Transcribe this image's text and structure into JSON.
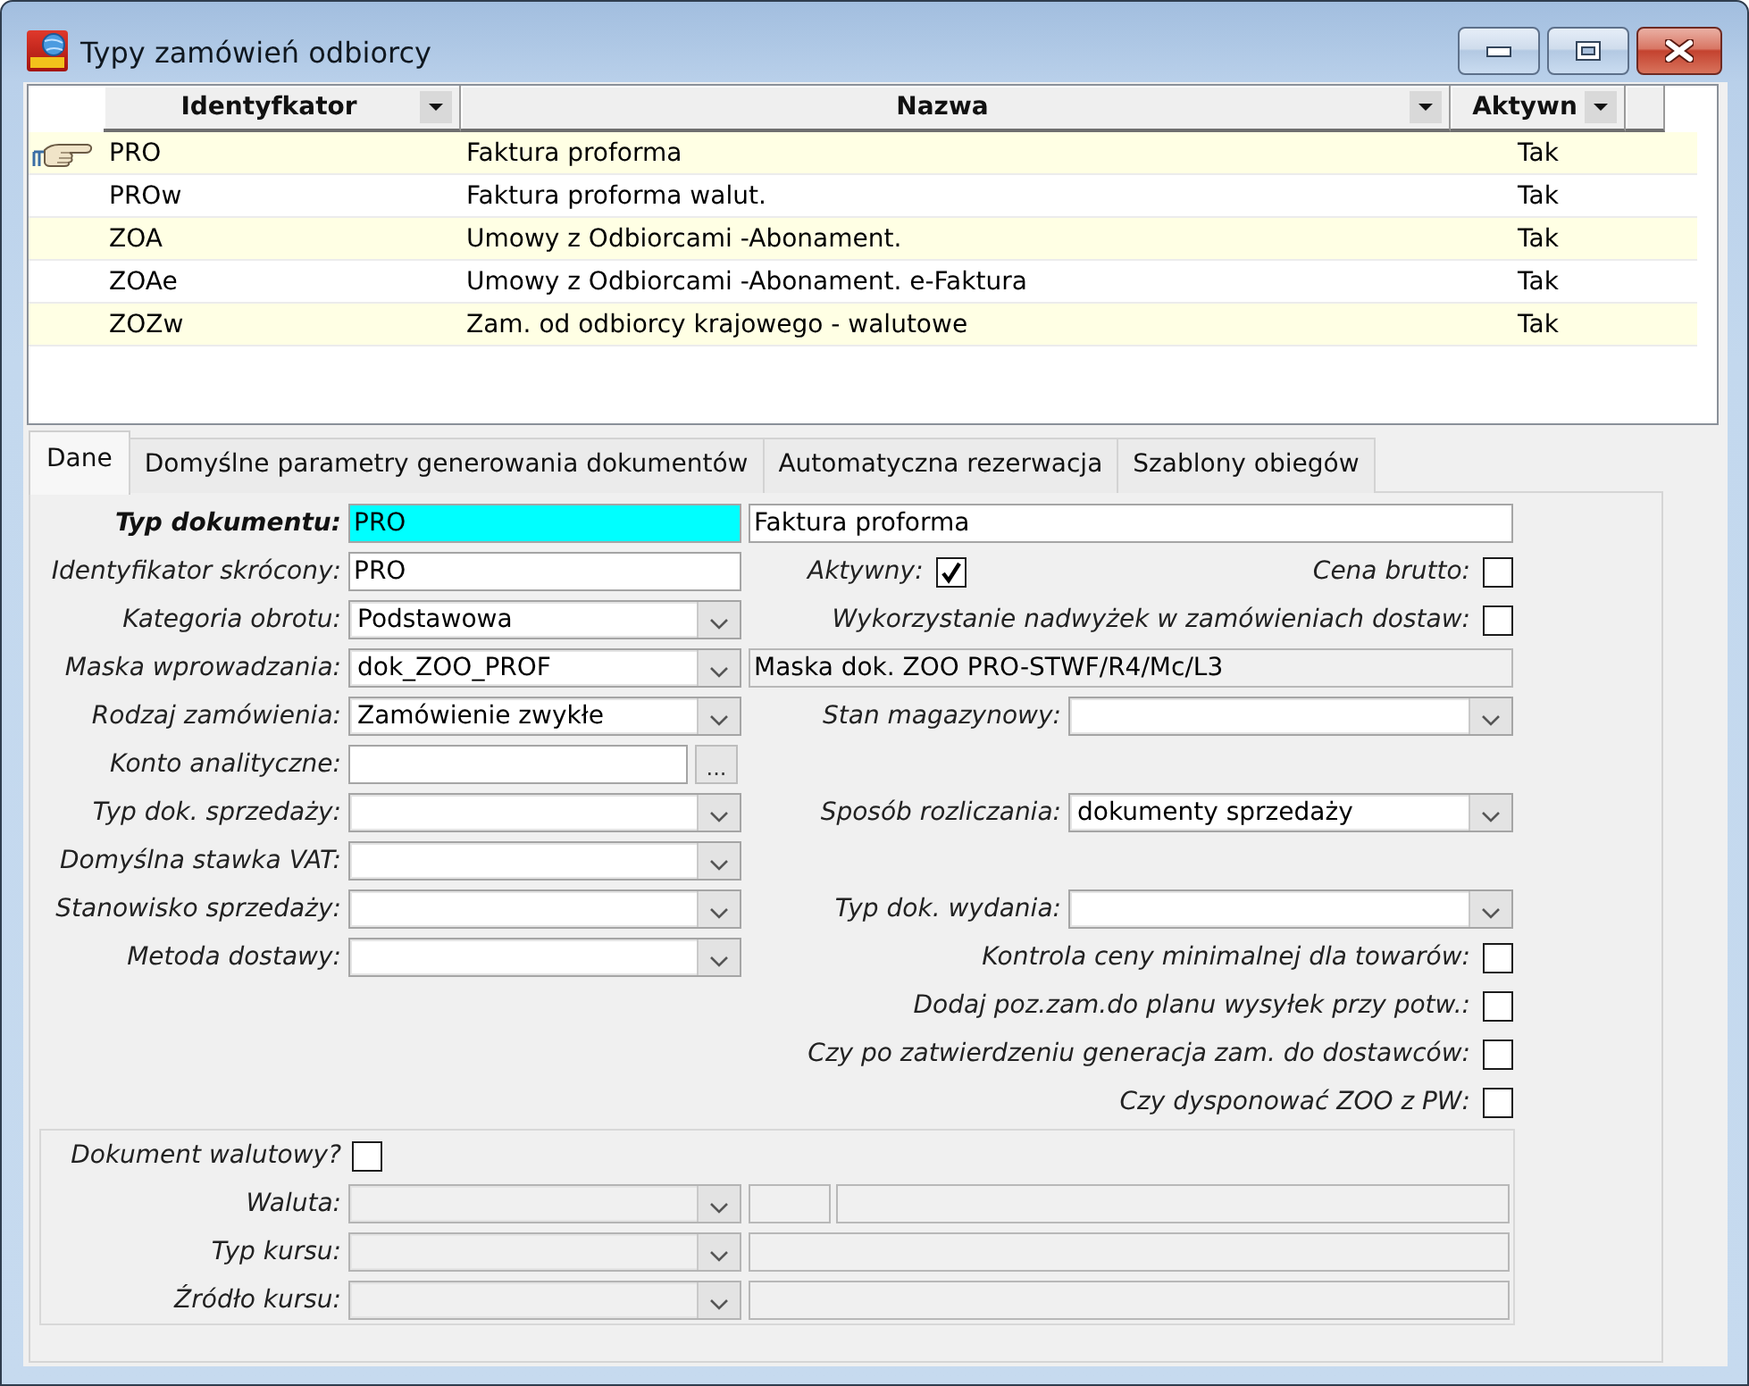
{
  "window": {
    "title": "Typy zamówień odbiorcy"
  },
  "grid": {
    "columns": [
      {
        "label": "Identyfkator"
      },
      {
        "label": "Nazwa"
      },
      {
        "label": "Aktywn"
      }
    ],
    "rows": [
      {
        "cells": [
          "PRO",
          "Faktura proforma",
          "Tak"
        ],
        "selected": true
      },
      {
        "cells": [
          "PROw",
          "Faktura proforma walut.",
          "Tak"
        ],
        "selected": false
      },
      {
        "cells": [
          "ZOA",
          "Umowy z Odbiorcami -Abonament.",
          "Tak"
        ],
        "selected": false
      },
      {
        "cells": [
          "ZOAe",
          "Umowy z Odbiorcami -Abonament. e-Faktura",
          "Tak"
        ],
        "selected": false
      },
      {
        "cells": [
          "ZOZw",
          "Zam. od odbiorcy krajowego - walutowe",
          "Tak"
        ],
        "selected": false
      }
    ]
  },
  "tabs": [
    {
      "label": "Dane",
      "selected": true
    },
    {
      "label": "Domyślne parametry generowania dokumentów",
      "selected": false
    },
    {
      "label": "Automatyczna rezerwacja",
      "selected": false
    },
    {
      "label": "Szablony obiegów",
      "selected": false
    }
  ],
  "form": {
    "rows": [
      {
        "left": {
          "kind": "text",
          "label": "Typ dokumentu:",
          "value": "PRO",
          "key_field": true
        },
        "right": [
          {
            "kind": "text",
            "value": "Faktura proforma"
          }
        ]
      },
      {
        "left": {
          "kind": "text",
          "label": "Identyfikator skrócony:",
          "value": "PRO",
          "key_field": false
        },
        "right": [
          {
            "kind": "check",
            "label": "Aktywny:",
            "checked": true
          },
          {
            "kind": "check",
            "label": "Cena brutto:",
            "checked": false
          }
        ]
      },
      {
        "left": {
          "kind": "combo",
          "label": "Kategoria obrotu:",
          "value": "Podstawowa",
          "key_field": false
        },
        "right": [
          {
            "kind": "check",
            "label": "Wykorzystanie nadwyżek w zamówieniach dostaw:",
            "checked": false
          }
        ]
      },
      {
        "left": {
          "kind": "combo",
          "label": "Maska wprowadzania:",
          "value": "dok_ZOO_PROF",
          "key_field": false
        },
        "right": [
          {
            "kind": "readonly",
            "value": "Maska dok. ZOO PRO-STWF/R4/Mc/L3"
          }
        ]
      },
      {
        "left": {
          "kind": "combo",
          "label": "Rodzaj zamówienia:",
          "value": "Zamówienie zwykłe",
          "key_field": false
        },
        "right": [
          {
            "kind": "combo",
            "label": "Stan magazynowy:"
          }
        ]
      },
      {
        "left": {
          "kind": "browse",
          "label": "Konto analityczne:",
          "button": "...",
          "key_field": false
        }
      },
      {
        "left": {
          "kind": "combo",
          "label": "Typ dok. sprzedaży:",
          "key_field": false
        },
        "right": [
          {
            "kind": "combo",
            "label": "Sposób rozliczania:",
            "value": "dokumenty sprzedaży"
          }
        ]
      },
      {
        "left": {
          "kind": "combo",
          "label": "Domyślna stawka VAT:",
          "key_field": false
        }
      },
      {
        "left": {
          "kind": "combo",
          "label": "Stanowisko sprzedaży:",
          "key_field": false
        },
        "right": [
          {
            "kind": "combo",
            "label": "Typ dok. wydania:"
          }
        ]
      },
      {
        "left": {
          "kind": "combo",
          "label": "Metoda dostawy:",
          "key_field": false
        },
        "right": [
          {
            "kind": "check",
            "label": "Kontrola ceny minimalnej dla towarów:",
            "checked": false
          }
        ]
      },
      {
        "right": [
          {
            "kind": "check",
            "label": "Dodaj poz.zam.do planu wysyłek przy potw.:",
            "checked": false
          }
        ]
      },
      {
        "right": [
          {
            "kind": "check",
            "label": "Czy po zatwierdzeniu generacja zam. do dostawców:",
            "checked": false
          }
        ]
      },
      {
        "right": [
          {
            "kind": "check",
            "label": "Czy dysponować ZOO z PW:",
            "checked": false
          }
        ]
      }
    ]
  },
  "currency": {
    "check": {
      "label": "Dokument walutowy?",
      "checked": false
    },
    "rows": [
      {
        "kind": "split",
        "label": "Waluta:",
        "disabled": true
      },
      {
        "kind": "single",
        "label": "Typ kursu:",
        "disabled": true
      },
      {
        "kind": "single",
        "label": "Źródło kursu:",
        "disabled": true
      }
    ]
  }
}
